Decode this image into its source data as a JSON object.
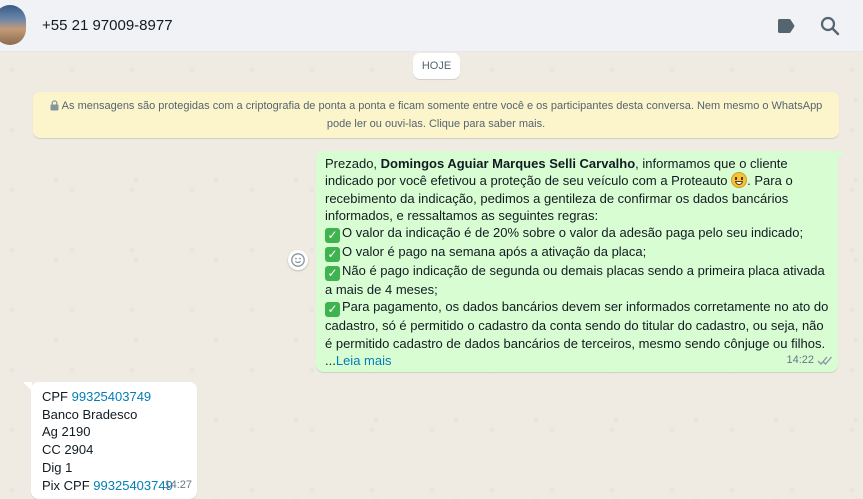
{
  "header": {
    "contact_name": "+55 21 97009-8977",
    "icons": [
      "avatar",
      "label-icon",
      "search-icon"
    ]
  },
  "chat": {
    "date_label": "HOJE",
    "encryption_notice": "As mensagens são protegidas com a criptografia de ponta a ponta e ficam somente entre você e os participantes desta conversa. Nem mesmo o WhatsApp pode ler ou ouvi-las. Clique para saber mais.",
    "outgoing": {
      "greeting": "Prezado, ",
      "name": "Domingos Aguiar Marques Selli Carvalho",
      "intro": ", informamos que o cliente indicado por você efetivou a proteção de seu veículo com a Proteauto ",
      "intro_end": ". Para o recebimento da indicação, pedimos a gentileza de confirmar os dados bancários informados, e ressaltamos as seguintes regras:",
      "rules": [
        "O valor da indicação é de 20% sobre o valor da adesão paga pelo seu indicado;",
        "O valor é pago na semana após a ativação da placa;",
        "Não é pago indicação de segunda ou demais placas sendo a primeira placa ativada a mais de 4 meses;",
        "Para pagamento, os dados bancários devem ser informados corretamente no ato do cadastro, só é permitido o cadastro da conta sendo do titular do cadastro, ou seja, não é permitido cadastro de dados bancários de terceiros, mesmo sendo cônjuge ou filhos."
      ],
      "ellipsis": "...",
      "read_more": "Leia mais",
      "time": "14:22",
      "status": "delivered"
    },
    "incoming": {
      "cpf_label": "CPF ",
      "cpf_value": "99325403749",
      "bank": "Banco Bradesco",
      "agency": "Ag 2190",
      "account": "CC 2904",
      "digit": "Dig 1",
      "pix_label": "Pix CPF ",
      "pix_value": "99325403749",
      "time": "14:27"
    }
  },
  "colors": {
    "outgoing_bubble": "#d9fdd3",
    "incoming_bubble": "#ffffff",
    "link": "#027eb5",
    "notice_bg": "#fcf4cb",
    "chat_bg": "#efeae2"
  }
}
